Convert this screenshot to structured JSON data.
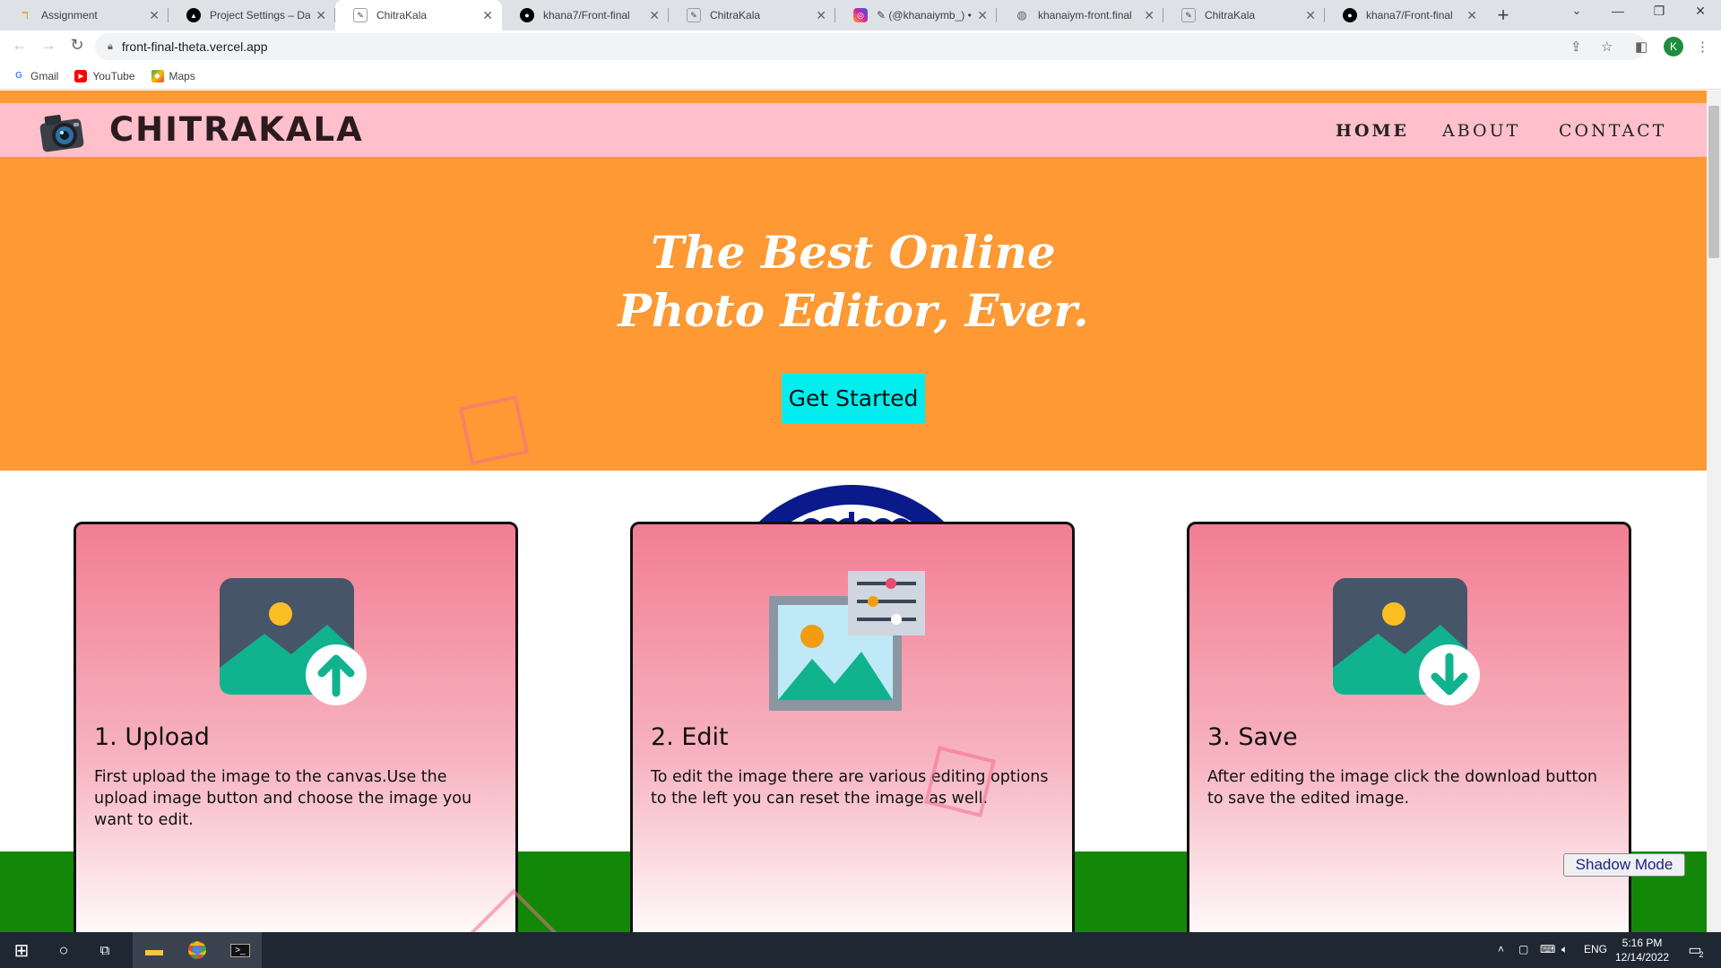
{
  "browser": {
    "tabs": [
      {
        "title": "Assignment",
        "icon": "doc-icon",
        "color": "#e8a33d"
      },
      {
        "title": "Project Settings – Dash",
        "icon": "vercel-icon",
        "color": "#000000"
      },
      {
        "title": "ChitraKala",
        "icon": "page-icon",
        "color": "#5f6368"
      },
      {
        "title": "khana7/Front-final",
        "icon": "github-icon",
        "color": "#000000"
      },
      {
        "title": "ChitraKala",
        "icon": "page-icon",
        "color": "#5f6368"
      },
      {
        "title": "✎ (@khanaiymb_) • I",
        "icon": "instagram-icon",
        "color": "#d6249f"
      },
      {
        "title": "khanaiym-front.final",
        "icon": "globe-icon",
        "color": "#5f6368"
      },
      {
        "title": "ChitraKala",
        "icon": "page-icon",
        "color": "#5f6368"
      },
      {
        "title": "khana7/Front-final",
        "icon": "github-icon",
        "color": "#000000"
      }
    ],
    "active_tab": 2,
    "address": "front-final-theta.vercel.app",
    "profile_initial": "K",
    "bookmarks": [
      {
        "label": "Gmail",
        "icon": "google-icon"
      },
      {
        "label": "YouTube",
        "icon": "youtube-icon"
      },
      {
        "label": "Maps",
        "icon": "maps-icon"
      }
    ]
  },
  "site": {
    "brand": "CHITRAKALA",
    "nav": {
      "home": "HOME",
      "about": "ABOUT",
      "contact": "CONTACT"
    },
    "hero": {
      "title_line1": "The Best Online",
      "title_line2": "Photo Editor, Ever.",
      "cta": "Get Started"
    },
    "cards": [
      {
        "title": "1. Upload",
        "text": "First upload the image to the canvas.Use the upload image button and choose the image you want to edit.",
        "icon": "image-upload-icon"
      },
      {
        "title": "2. Edit",
        "text": "To edit the image there are various editing options to the left you can reset the image as well.",
        "icon": "image-edit-icon"
      },
      {
        "title": "3. Save",
        "text": "After editing the image click the download button to save the edited image.",
        "icon": "image-download-icon"
      }
    ],
    "shadow_mode": "Shadow Mode",
    "colors": {
      "saffron": "#ff9933",
      "pink": "#ffc0cb",
      "green": "#138808",
      "navy": "#0a1a8a",
      "cta": "#00eeee"
    }
  },
  "taskbar": {
    "language": "ENG",
    "time": "5:16 PM",
    "date": "12/14/2022",
    "notification_count": "2"
  }
}
